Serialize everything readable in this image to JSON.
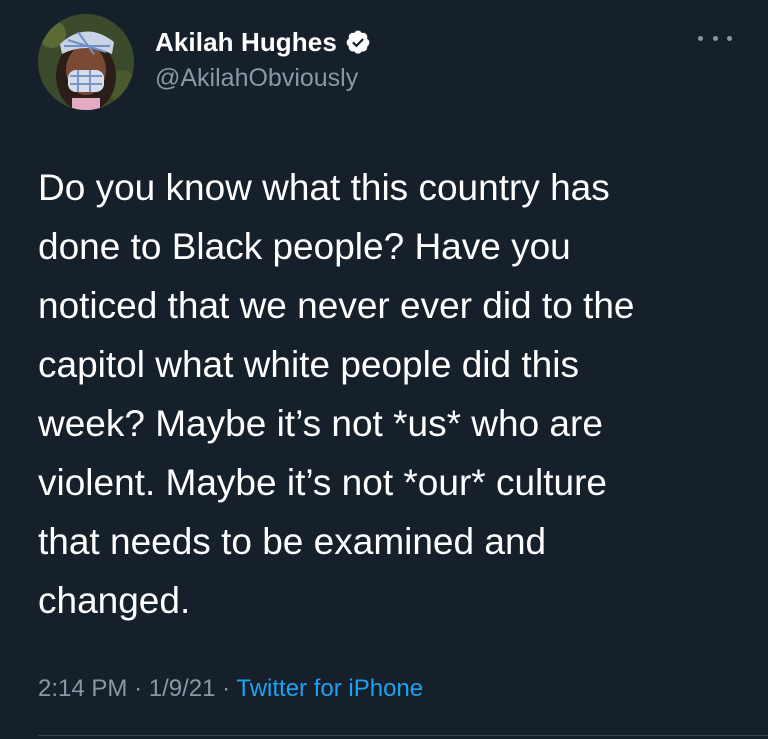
{
  "tweet": {
    "display_name": "Akilah Hughes",
    "handle": "@AkilahObviously",
    "verified": true,
    "text": "Do you know what this country has\ndone to Black people? Have you\nnoticed that we never ever did to the\ncapitol what white people did this\nweek? Maybe it’s not *us* who are\nviolent. Maybe it’s not *our* culture\nthat needs to be examined and\nchanged.",
    "time": "2:14 PM",
    "separator": "·",
    "date": "1/9/21",
    "source": "Twitter for iPhone"
  },
  "icons": {
    "verified": "verified-badge-icon",
    "more": "more-options-icon"
  },
  "colors": {
    "background": "#15202b",
    "text": "#ffffff",
    "secondary_text": "#8899a6",
    "link": "#1da1f2"
  }
}
